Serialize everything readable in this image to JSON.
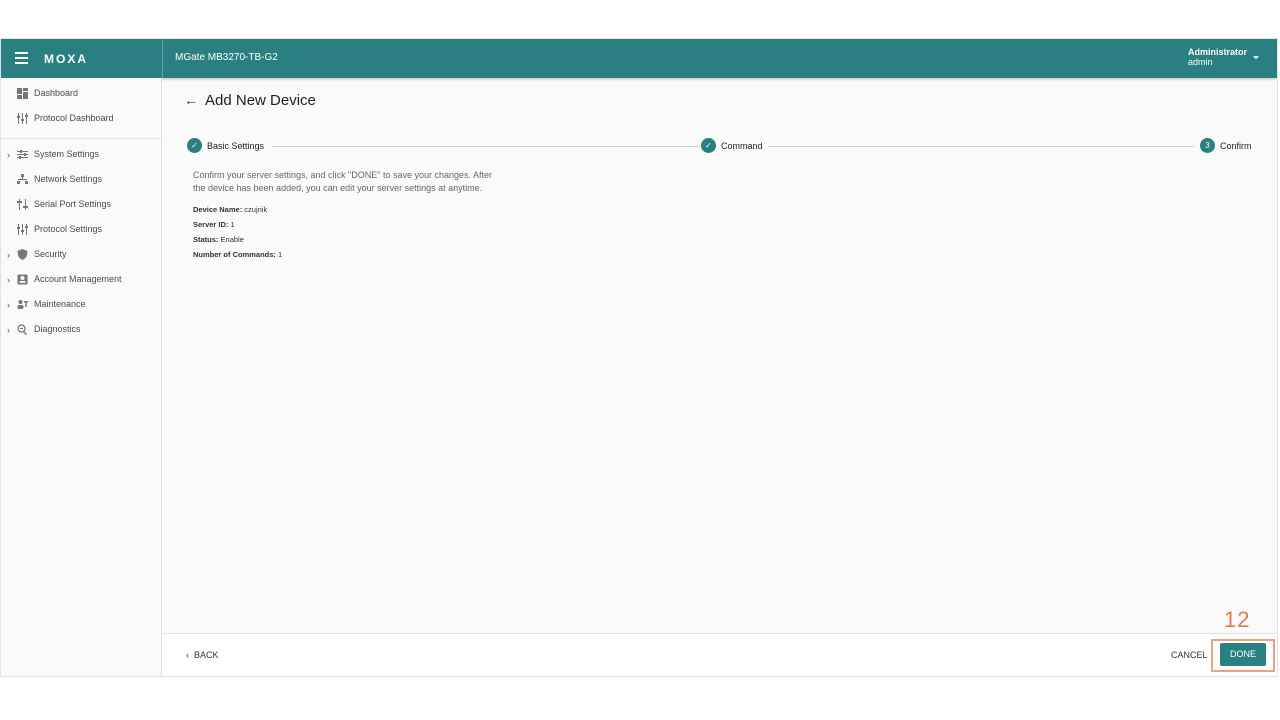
{
  "header": {
    "logo_text": "MOXA",
    "device_title": "MGate MB3270-TB-G2",
    "user_role": "Administrator",
    "user_name": "admin"
  },
  "sidebar": {
    "items": [
      {
        "label": "Dashboard",
        "icon": "dashboard-icon",
        "expandable": false
      },
      {
        "label": "Protocol Dashboard",
        "icon": "protocol-dashboard-icon",
        "expandable": false
      },
      {
        "label": "System Settings",
        "icon": "sliders-icon",
        "expandable": true
      },
      {
        "label": "Network Settings",
        "icon": "network-icon",
        "expandable": false
      },
      {
        "label": "Serial Port Settings",
        "icon": "serial-port-icon",
        "expandable": false
      },
      {
        "label": "Protocol Settings",
        "icon": "protocol-settings-icon",
        "expandable": false
      },
      {
        "label": "Security",
        "icon": "shield-icon",
        "expandable": true
      },
      {
        "label": "Account Management",
        "icon": "account-icon",
        "expandable": true
      },
      {
        "label": "Maintenance",
        "icon": "maintenance-icon",
        "expandable": true
      },
      {
        "label": "Diagnostics",
        "icon": "diagnostics-icon",
        "expandable": true
      }
    ]
  },
  "main": {
    "title": "Add New Device",
    "steps": [
      {
        "label": "Basic Settings",
        "marker": "✓"
      },
      {
        "label": "Command",
        "marker": "✓"
      },
      {
        "label": "Confirm",
        "marker": "3"
      }
    ],
    "description": "Confirm your server settings, and click \"DONE\" to save your changes. After the device has been added, you can edit your server settings at anytime.",
    "info": [
      {
        "key": "Device Name:",
        "value": "czujnik"
      },
      {
        "key": "Server ID:",
        "value": "1"
      },
      {
        "key": "Status:",
        "value": "Enable"
      },
      {
        "key": "Number of Commands:",
        "value": "1"
      }
    ]
  },
  "footer": {
    "back_label": "BACK",
    "cancel_label": "CANCEL",
    "done_label": "DONE"
  },
  "annotation": {
    "number": "12"
  },
  "colors": {
    "accent": "#2a8080",
    "annotation": "#e07a4a"
  }
}
